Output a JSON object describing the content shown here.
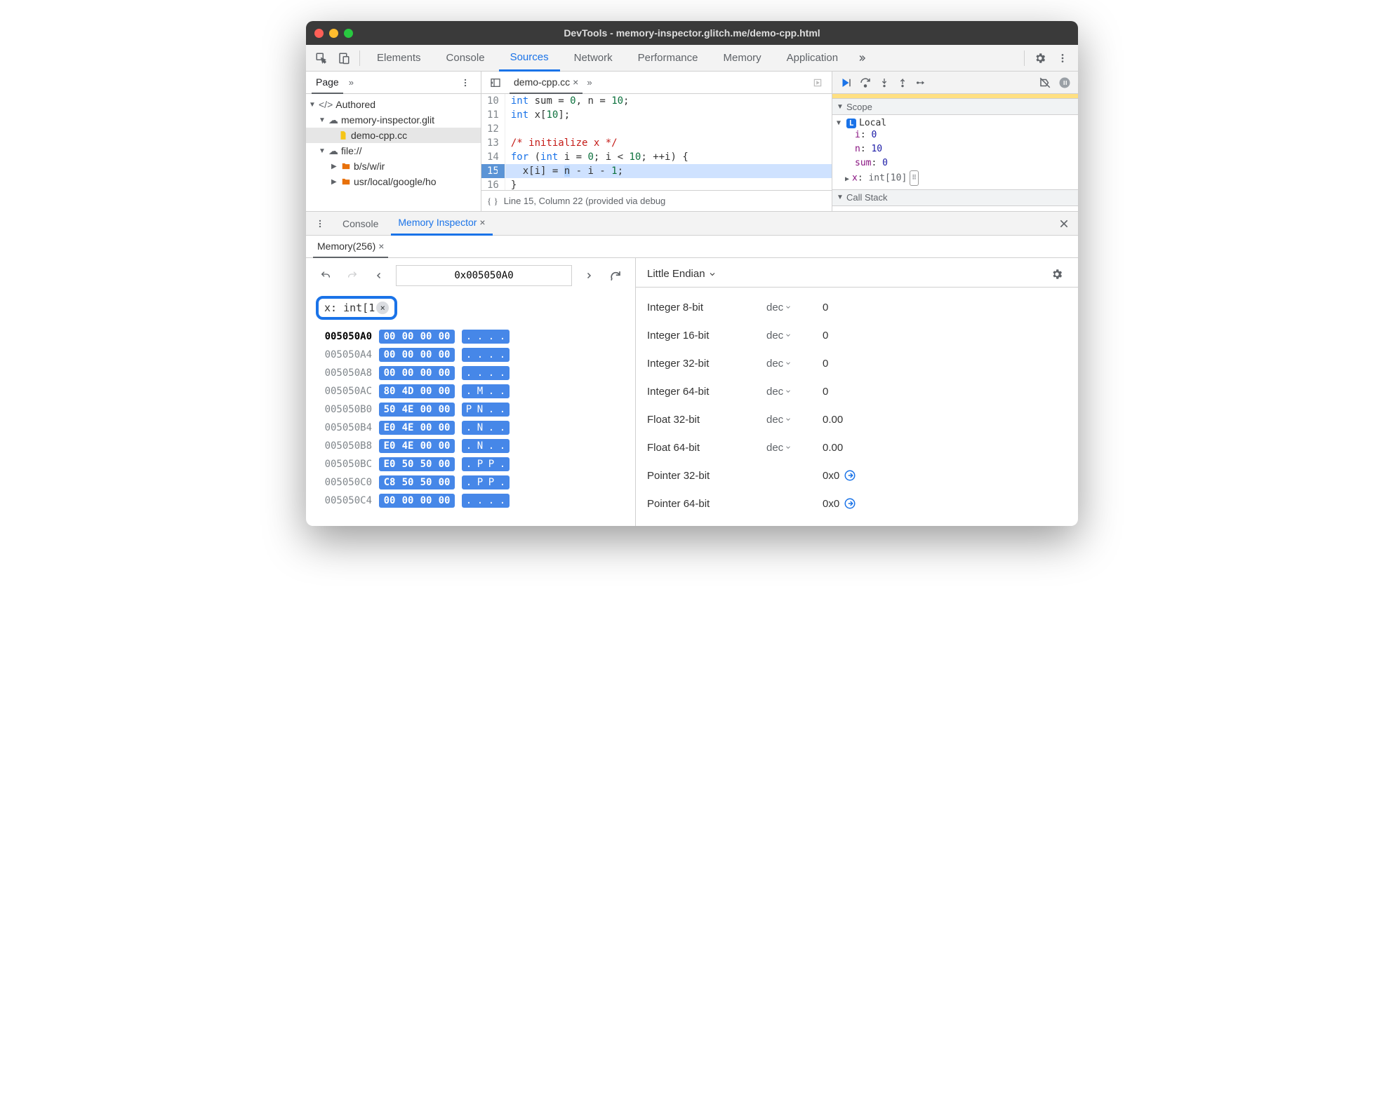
{
  "window_title": "DevTools - memory-inspector.glitch.me/demo-cpp.html",
  "tabs": [
    "Elements",
    "Console",
    "Sources",
    "Network",
    "Performance",
    "Memory",
    "Application"
  ],
  "active_tab": "Sources",
  "page_tab": "Page",
  "tree": {
    "authored": "Authored",
    "domain": "memory-inspector.glit",
    "file": "demo-cpp.cc",
    "fileproto": "file://",
    "path1": "b/s/w/ir",
    "path2": "usr/local/google/ho"
  },
  "editor_tab": "demo-cpp.cc",
  "code": {
    "l10": "int sum = 0, n = 10;",
    "l11": "int x[10];",
    "l12": "",
    "l13": "/* initialize x */",
    "l14": "for (int i = 0; i < 10; ++i) {",
    "l15": "  x[i] = n - i - 1;",
    "l16": "}"
  },
  "gutter": [
    "10",
    "11",
    "12",
    "13",
    "14",
    "15",
    "16"
  ],
  "code_status": "Line 15, Column 22 (provided via debug",
  "scope_label": "Scope",
  "local_label": "Local",
  "scope_vars": {
    "i_name": "i",
    "i_val": "0",
    "n_name": "n",
    "n_val": "10",
    "sum_name": "sum",
    "sum_val": "0",
    "x_name": "x",
    "x_type": "int[10]"
  },
  "callstack_label": "Call Stack",
  "drawer": {
    "console": "Console",
    "mi": "Memory Inspector"
  },
  "mem_tab": "Memory(256)",
  "address": "0x005050A0",
  "var_chip": "x: int[1",
  "hex_rows": [
    {
      "addr": "005050A0",
      "b": [
        "00",
        "00",
        "00",
        "00"
      ],
      "a": [
        ".",
        ".",
        ".",
        "."
      ],
      "cur": true
    },
    {
      "addr": "005050A4",
      "b": [
        "00",
        "00",
        "00",
        "00"
      ],
      "a": [
        ".",
        ".",
        ".",
        "."
      ]
    },
    {
      "addr": "005050A8",
      "b": [
        "00",
        "00",
        "00",
        "00"
      ],
      "a": [
        ".",
        ".",
        ".",
        "."
      ]
    },
    {
      "addr": "005050AC",
      "b": [
        "80",
        "4D",
        "00",
        "00"
      ],
      "a": [
        ".",
        "M",
        ".",
        "."
      ]
    },
    {
      "addr": "005050B0",
      "b": [
        "50",
        "4E",
        "00",
        "00"
      ],
      "a": [
        "P",
        "N",
        ".",
        "."
      ]
    },
    {
      "addr": "005050B4",
      "b": [
        "E0",
        "4E",
        "00",
        "00"
      ],
      "a": [
        ".",
        "N",
        ".",
        "."
      ]
    },
    {
      "addr": "005050B8",
      "b": [
        "E0",
        "4E",
        "00",
        "00"
      ],
      "a": [
        ".",
        "N",
        ".",
        "."
      ]
    },
    {
      "addr": "005050BC",
      "b": [
        "E0",
        "50",
        "50",
        "00"
      ],
      "a": [
        ".",
        "P",
        "P",
        "."
      ]
    },
    {
      "addr": "005050C0",
      "b": [
        "C8",
        "50",
        "50",
        "00"
      ],
      "a": [
        ".",
        "P",
        "P",
        "."
      ]
    },
    {
      "addr": "005050C4",
      "b": [
        "00",
        "00",
        "00",
        "00"
      ],
      "a": [
        ".",
        ".",
        ".",
        "."
      ]
    }
  ],
  "endian": "Little Endian",
  "interpretations": [
    {
      "name": "Integer 8-bit",
      "fmt": "dec",
      "val": "0"
    },
    {
      "name": "Integer 16-bit",
      "fmt": "dec",
      "val": "0"
    },
    {
      "name": "Integer 32-bit",
      "fmt": "dec",
      "val": "0"
    },
    {
      "name": "Integer 64-bit",
      "fmt": "dec",
      "val": "0"
    },
    {
      "name": "Float 32-bit",
      "fmt": "dec",
      "val": "0.00"
    },
    {
      "name": "Float 64-bit",
      "fmt": "dec",
      "val": "0.00"
    },
    {
      "name": "Pointer 32-bit",
      "fmt": "",
      "val": "0x0",
      "jump": true
    },
    {
      "name": "Pointer 64-bit",
      "fmt": "",
      "val": "0x0",
      "jump": true
    }
  ]
}
